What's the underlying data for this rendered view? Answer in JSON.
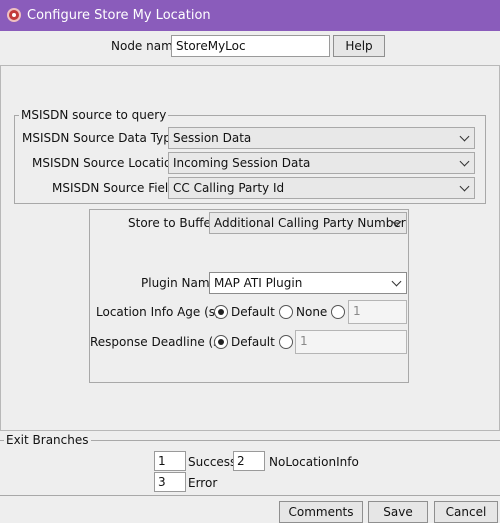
{
  "window": {
    "title": "Configure Store My Location"
  },
  "header": {
    "node_name_label": "Node name",
    "node_name_value": "StoreMyLoc",
    "help_label": "Help"
  },
  "msisdn_source": {
    "legend": "MSISDN source to query",
    "data_type_label": "MSISDN Source Data Type",
    "data_type_value": "Session Data",
    "location_label": "MSISDN Source Location",
    "location_value": "Incoming Session Data",
    "field_label": "MSISDN Source Field",
    "field_value": "CC Calling Party Id"
  },
  "options": {
    "store_to_buffer_label": "Store to Buffer",
    "store_to_buffer_value": "Additional Calling Party Number",
    "plugin_name_label": "Plugin Name",
    "plugin_name_value": "MAP ATI Plugin",
    "location_info_age_label": "Location Info Age (s)",
    "location_info_age_default": "Default",
    "location_info_age_none": "None",
    "location_info_age_custom_value": "1",
    "response_deadline_label": "Response Deadline (s)",
    "response_deadline_default": "Default",
    "response_deadline_custom_value": "1"
  },
  "exit_branches": {
    "legend": "Exit Branches",
    "items": [
      {
        "number": "1",
        "name": "Success"
      },
      {
        "number": "2",
        "name": "NoLocationInfo"
      },
      {
        "number": "3",
        "name": "Error"
      }
    ]
  },
  "footer": {
    "comments_label": "Comments",
    "save_label": "Save",
    "cancel_label": "Cancel"
  }
}
